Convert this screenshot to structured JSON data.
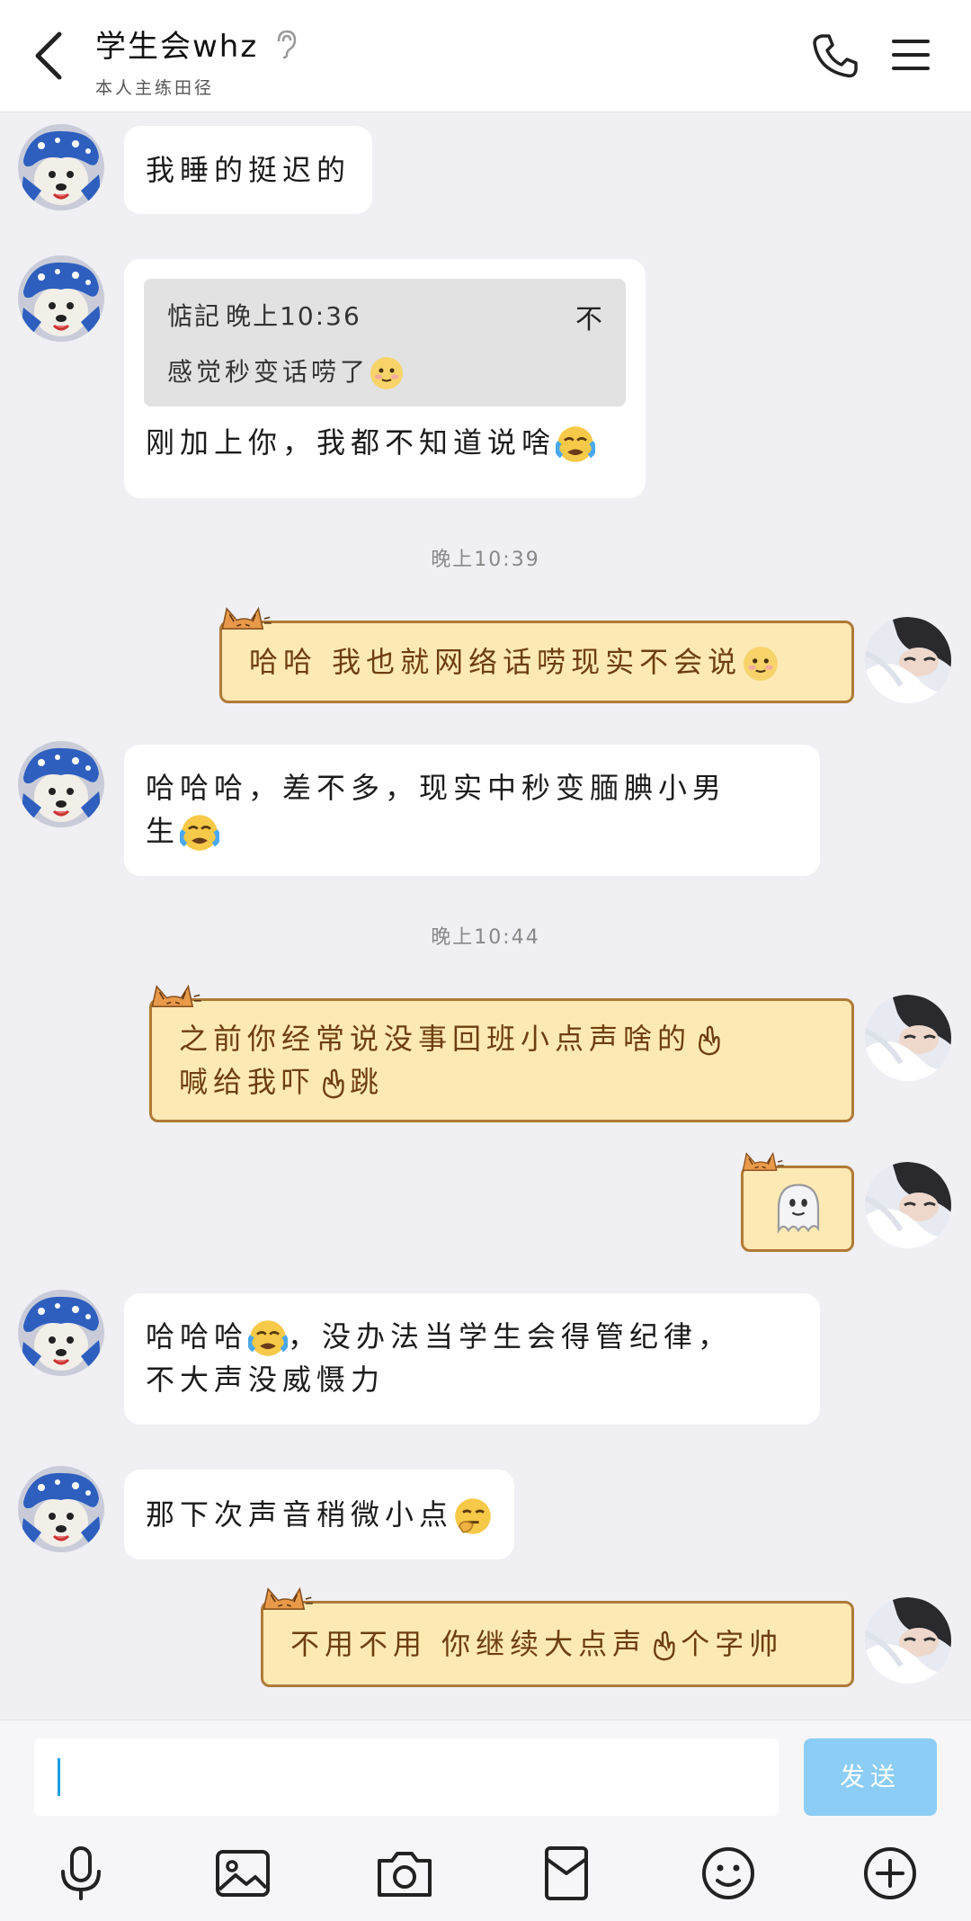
{
  "header": {
    "title": "学生会whz",
    "subtitle": "本人主练田径",
    "icons": [
      "back-arrow-icon",
      "ear-icon",
      "phone-icon",
      "menu-icon"
    ]
  },
  "messages": [
    {
      "side": "left",
      "text": "我睡的挺迟的"
    },
    {
      "side": "left",
      "quote": {
        "author": "惦記",
        "time": "晚上10:36",
        "close": "不",
        "text": "感觉秒变话唠了"
      },
      "text": "刚加上你，我都不知道说啥"
    },
    {
      "type": "time",
      "text": "晚上10:39"
    },
    {
      "side": "right",
      "text": "哈哈 我也就网络话唠现实不会说"
    },
    {
      "side": "left",
      "line1": "哈哈哈，差不多，现实中秒变腼腆小男",
      "line2": "生"
    },
    {
      "type": "time",
      "text": "晚上10:44"
    },
    {
      "side": "right",
      "line1": "之前你经常说没事回班小点声啥的",
      "line2": "喊给我吓",
      "line2b": "跳"
    },
    {
      "side": "right",
      "emoji": "ghost"
    },
    {
      "side": "left",
      "line1a": "哈哈哈",
      "line1b": "，没办法当学生会得管纪律，",
      "line2": "不大声没威慑力"
    },
    {
      "side": "left",
      "text": "那下次声音稍微小点"
    },
    {
      "side": "right",
      "text1": "不用不用 你继续大点声",
      "text2": "个字帅"
    }
  ],
  "input": {
    "placeholder": "",
    "send_label": "发送"
  },
  "toolbar": [
    "microphone-icon",
    "image-icon",
    "camera-icon",
    "red-packet-icon",
    "emoji-icon",
    "plus-icon"
  ],
  "colors": {
    "accent": "#8ccdf5",
    "bubble_self": "#fde9b3",
    "bubble_border": "#b07a38",
    "background": "#efeff4"
  }
}
